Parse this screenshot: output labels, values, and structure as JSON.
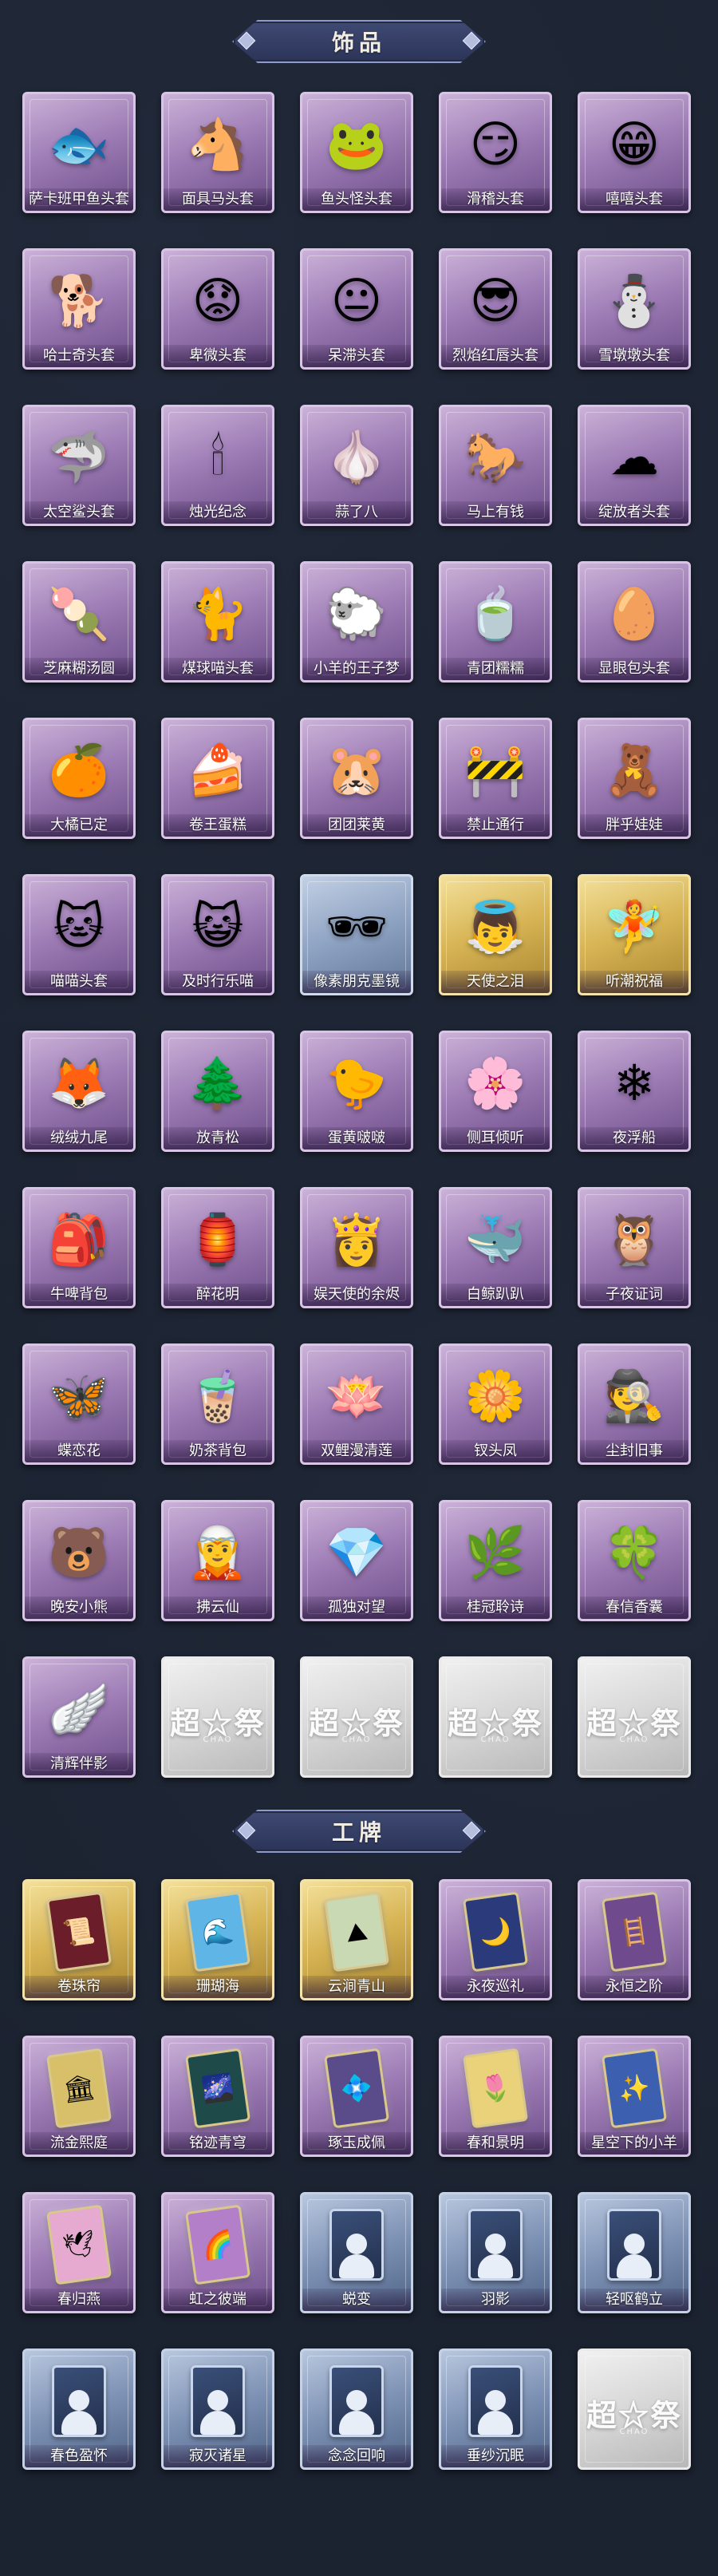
{
  "sections": [
    {
      "title": "饰品",
      "items": [
        {
          "label": "萨卡班甲鱼头套",
          "style": "purple",
          "icon": "🐟"
        },
        {
          "label": "面具马头套",
          "style": "purple",
          "icon": "🐴"
        },
        {
          "label": "鱼头怪头套",
          "style": "purple",
          "icon": "🐸"
        },
        {
          "label": "滑稽头套",
          "style": "purple",
          "icon": "😏"
        },
        {
          "label": "嘻嘻头套",
          "style": "purple",
          "icon": "😁"
        },
        {
          "label": "哈士奇头套",
          "style": "purple",
          "icon": "🐕"
        },
        {
          "label": "卑微头套",
          "style": "purple",
          "icon": "😟"
        },
        {
          "label": "呆滞头套",
          "style": "purple",
          "icon": "😐"
        },
        {
          "label": "烈焰红唇头套",
          "style": "purple",
          "icon": "😎"
        },
        {
          "label": "雪墩墩头套",
          "style": "purple",
          "icon": "⛄"
        },
        {
          "label": "太空鲨头套",
          "style": "purple",
          "icon": "🦈"
        },
        {
          "label": "烛光纪念",
          "style": "purple",
          "icon": "🕯"
        },
        {
          "label": "蒜了八",
          "style": "purple",
          "icon": "🧄"
        },
        {
          "label": "马上有钱",
          "style": "purple",
          "icon": "🐎"
        },
        {
          "label": "绽放者头套",
          "style": "purple",
          "icon": "☁"
        },
        {
          "label": "芝麻糊汤圆",
          "style": "purple",
          "icon": "🍡"
        },
        {
          "label": "煤球喵头套",
          "style": "purple",
          "icon": "🐈"
        },
        {
          "label": "小羊的王子梦",
          "style": "purple",
          "icon": "🐑"
        },
        {
          "label": "青团糯糯",
          "style": "purple",
          "icon": "🍵"
        },
        {
          "label": "显眼包头套",
          "style": "purple",
          "icon": "🥚"
        },
        {
          "label": "大橘已定",
          "style": "purple",
          "icon": "🍊"
        },
        {
          "label": "卷王蛋糕",
          "style": "purple",
          "icon": "🍰"
        },
        {
          "label": "团团莱黄",
          "style": "purple",
          "icon": "🐹"
        },
        {
          "label": "禁止通行",
          "style": "purple",
          "icon": "🚧"
        },
        {
          "label": "胖乎娃娃",
          "style": "purple",
          "icon": "🧸"
        },
        {
          "label": "喵喵头套",
          "style": "purple",
          "icon": "🐱"
        },
        {
          "label": "及时行乐喵",
          "style": "purple",
          "icon": "😺"
        },
        {
          "label": "像素朋克墨镜",
          "style": "blue",
          "icon": "🕶"
        },
        {
          "label": "天使之泪",
          "style": "gold",
          "icon": "👼"
        },
        {
          "label": "听潮祝福",
          "style": "gold",
          "icon": "🧚"
        },
        {
          "label": "绒绒九尾",
          "style": "purple",
          "icon": "🦊"
        },
        {
          "label": "放青松",
          "style": "purple",
          "icon": "🌲"
        },
        {
          "label": "蛋黄啵啵",
          "style": "purple",
          "icon": "🐤"
        },
        {
          "label": "侧耳倾听",
          "style": "purple",
          "icon": "🌸"
        },
        {
          "label": "夜浮船",
          "style": "purple",
          "icon": "❄"
        },
        {
          "label": "牛啤背包",
          "style": "purple",
          "icon": "🎒"
        },
        {
          "label": "醉花明",
          "style": "purple",
          "icon": "🏮"
        },
        {
          "label": "娱天使的余烬",
          "style": "purple",
          "icon": "👸"
        },
        {
          "label": "白鲸趴趴",
          "style": "purple",
          "icon": "🐳"
        },
        {
          "label": "子夜证词",
          "style": "purple",
          "icon": "🦉"
        },
        {
          "label": "蝶恋花",
          "style": "purple",
          "icon": "🦋"
        },
        {
          "label": "奶茶背包",
          "style": "purple",
          "icon": "🧋"
        },
        {
          "label": "双鲤漫清莲",
          "style": "purple",
          "icon": "🪷"
        },
        {
          "label": "钗头凤",
          "style": "purple",
          "icon": "🌼"
        },
        {
          "label": "尘封旧事",
          "style": "purple",
          "icon": "🕵"
        },
        {
          "label": "晚安小熊",
          "style": "purple",
          "icon": "🐻"
        },
        {
          "label": "拂云仙",
          "style": "purple",
          "icon": "🧝"
        },
        {
          "label": "孤独对望",
          "style": "purple",
          "icon": "💎"
        },
        {
          "label": "桂冠聆诗",
          "style": "purple",
          "icon": "🌿"
        },
        {
          "label": "春信香囊",
          "style": "purple",
          "icon": "🍀"
        },
        {
          "label": "清辉伴影",
          "style": "purple",
          "icon": "🪽"
        },
        {
          "label": "",
          "style": "silver",
          "placeholder": "超☆祭"
        },
        {
          "label": "",
          "style": "silver",
          "placeholder": "超☆祭"
        },
        {
          "label": "",
          "style": "silver",
          "placeholder": "超☆祭"
        },
        {
          "label": "",
          "style": "silver",
          "placeholder": "超☆祭"
        }
      ]
    },
    {
      "title": "工牌",
      "items": [
        {
          "label": "卷珠帘",
          "style": "gold",
          "icon": "📜",
          "tag_color": "#6b1d2a"
        },
        {
          "label": "珊瑚海",
          "style": "gold",
          "icon": "🌊",
          "tag_color": "#5fb6e6"
        },
        {
          "label": "云涧青山",
          "style": "gold",
          "icon": "⛰",
          "tag_color": "#c9d9b3"
        },
        {
          "label": "永夜巡礼",
          "style": "purple",
          "icon": "🌙",
          "tag_color": "#2b3a7a"
        },
        {
          "label": "永恒之阶",
          "style": "purple",
          "icon": "🪜",
          "tag_color": "#6f4a8c"
        },
        {
          "label": "流金熙庭",
          "style": "purple",
          "icon": "🏛",
          "tag_color": "#d8c06a"
        },
        {
          "label": "铭迹青穹",
          "style": "purple",
          "icon": "🌌",
          "tag_color": "#1f4a4a"
        },
        {
          "label": "琢玉成佩",
          "style": "purple",
          "icon": "💠",
          "tag_color": "#5a4c8a"
        },
        {
          "label": "春和景明",
          "style": "purple",
          "icon": "🌷",
          "tag_color": "#e9d27a"
        },
        {
          "label": "星空下的小羊",
          "style": "purple",
          "icon": "✨",
          "tag_color": "#3d5fb0"
        },
        {
          "label": "春归燕",
          "style": "purple",
          "icon": "🕊",
          "tag_color": "#e6a9cf"
        },
        {
          "label": "虹之彼端",
          "style": "purple",
          "icon": "🌈",
          "tag_color": "#b37fc9"
        },
        {
          "label": "蜕变",
          "style": "dark",
          "icon": "silhouette"
        },
        {
          "label": "羽影",
          "style": "dark",
          "icon": "silhouette"
        },
        {
          "label": "轻呕鹤立",
          "style": "dark",
          "icon": "silhouette"
        },
        {
          "label": "春色盈怀",
          "style": "dark",
          "icon": "silhouette"
        },
        {
          "label": "寂灭诸星",
          "style": "dark",
          "icon": "silhouette"
        },
        {
          "label": "念念回响",
          "style": "dark",
          "icon": "silhouette"
        },
        {
          "label": "垂纱沉眠",
          "style": "dark",
          "icon": "silhouette"
        },
        {
          "label": "",
          "style": "silver",
          "placeholder": "超☆祭"
        }
      ]
    }
  ],
  "placeholder_subtitle": "CHAO"
}
